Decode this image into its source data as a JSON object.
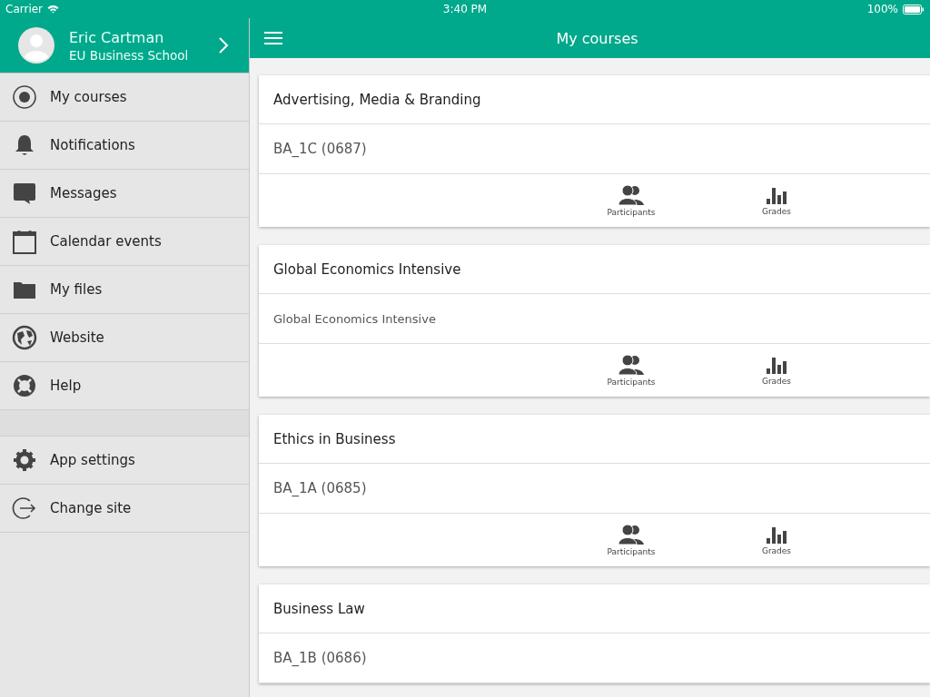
{
  "status_bar": {
    "carrier": "Carrier",
    "time": "3:40 PM",
    "battery": "100%"
  },
  "profile": {
    "name": "Eric Cartman",
    "site": "EU Business School"
  },
  "sidebar": {
    "items": [
      {
        "label": "My courses",
        "kind": "target"
      },
      {
        "label": "Notifications",
        "kind": "bell"
      },
      {
        "label": "Messages",
        "kind": "bubble"
      },
      {
        "label": "Calendar events",
        "kind": "calendar"
      },
      {
        "label": "My files",
        "kind": "folder"
      },
      {
        "label": "Website",
        "kind": "globe"
      },
      {
        "label": "Help",
        "kind": "lifebuoy"
      },
      {
        "label": "App settings",
        "kind": "gear",
        "group_break": true
      },
      {
        "label": "Change site",
        "kind": "exit"
      }
    ]
  },
  "header": {
    "title": "My courses"
  },
  "courses": [
    {
      "title": "Advertising, Media & Branding",
      "subtitle": "BA_1C (0687)",
      "actions": [
        {
          "label": "Participants",
          "kind": "people"
        },
        {
          "label": "Grades",
          "kind": "bars"
        }
      ]
    },
    {
      "title": "Global Economics Intensive",
      "subtitle": "Global Economics Intensive",
      "actions": [
        {
          "label": "Participants",
          "kind": "people"
        },
        {
          "label": "Grades",
          "kind": "bars"
        }
      ]
    },
    {
      "title": "Ethics in Business",
      "subtitle": "BA_1A (0685)",
      "actions": [
        {
          "label": "Participants",
          "kind": "people"
        },
        {
          "label": "Grades",
          "kind": "bars"
        }
      ]
    },
    {
      "title": "Business Law",
      "subtitle": "BA_1B (0686)"
    }
  ]
}
